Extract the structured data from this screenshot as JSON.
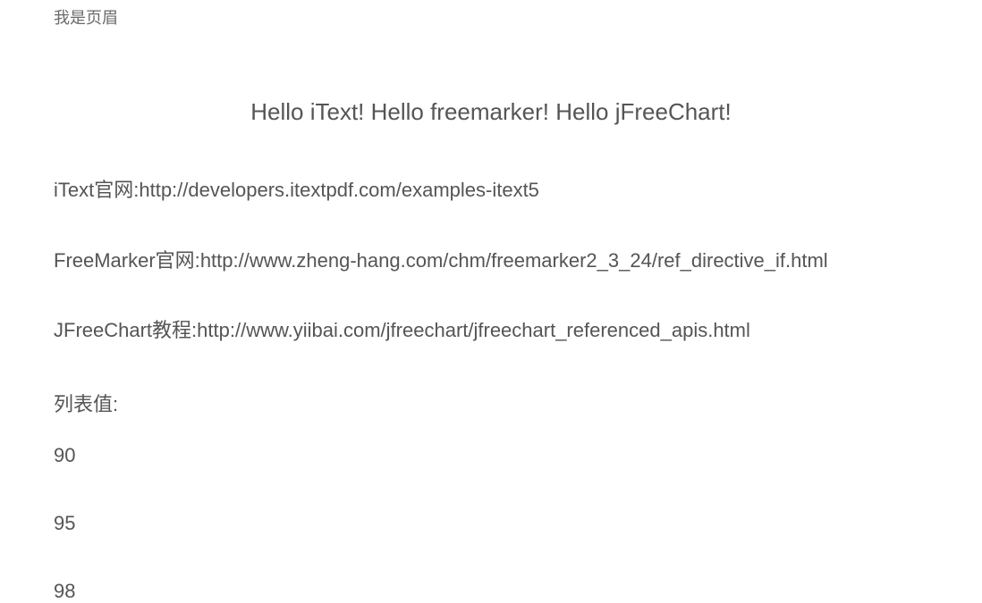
{
  "header": {
    "text": "我是页眉"
  },
  "title": "Hello iText! Hello freemarker! Hello jFreeChart!",
  "links": [
    {
      "label": "iText官网:",
      "url": "http://developers.itextpdf.com/examples-itext5"
    },
    {
      "label": "FreeMarker官网:",
      "url": "http://www.zheng-hang.com/chm/freemarker2_3_24/ref_directive_if.html"
    },
    {
      "label": "JFreeChart教程:",
      "url": "http://www.yiibai.com/jfreechart/jfreechart_referenced_apis.html"
    }
  ],
  "listLabel": "列表值:",
  "listValues": [
    "90",
    "95",
    "98"
  ]
}
